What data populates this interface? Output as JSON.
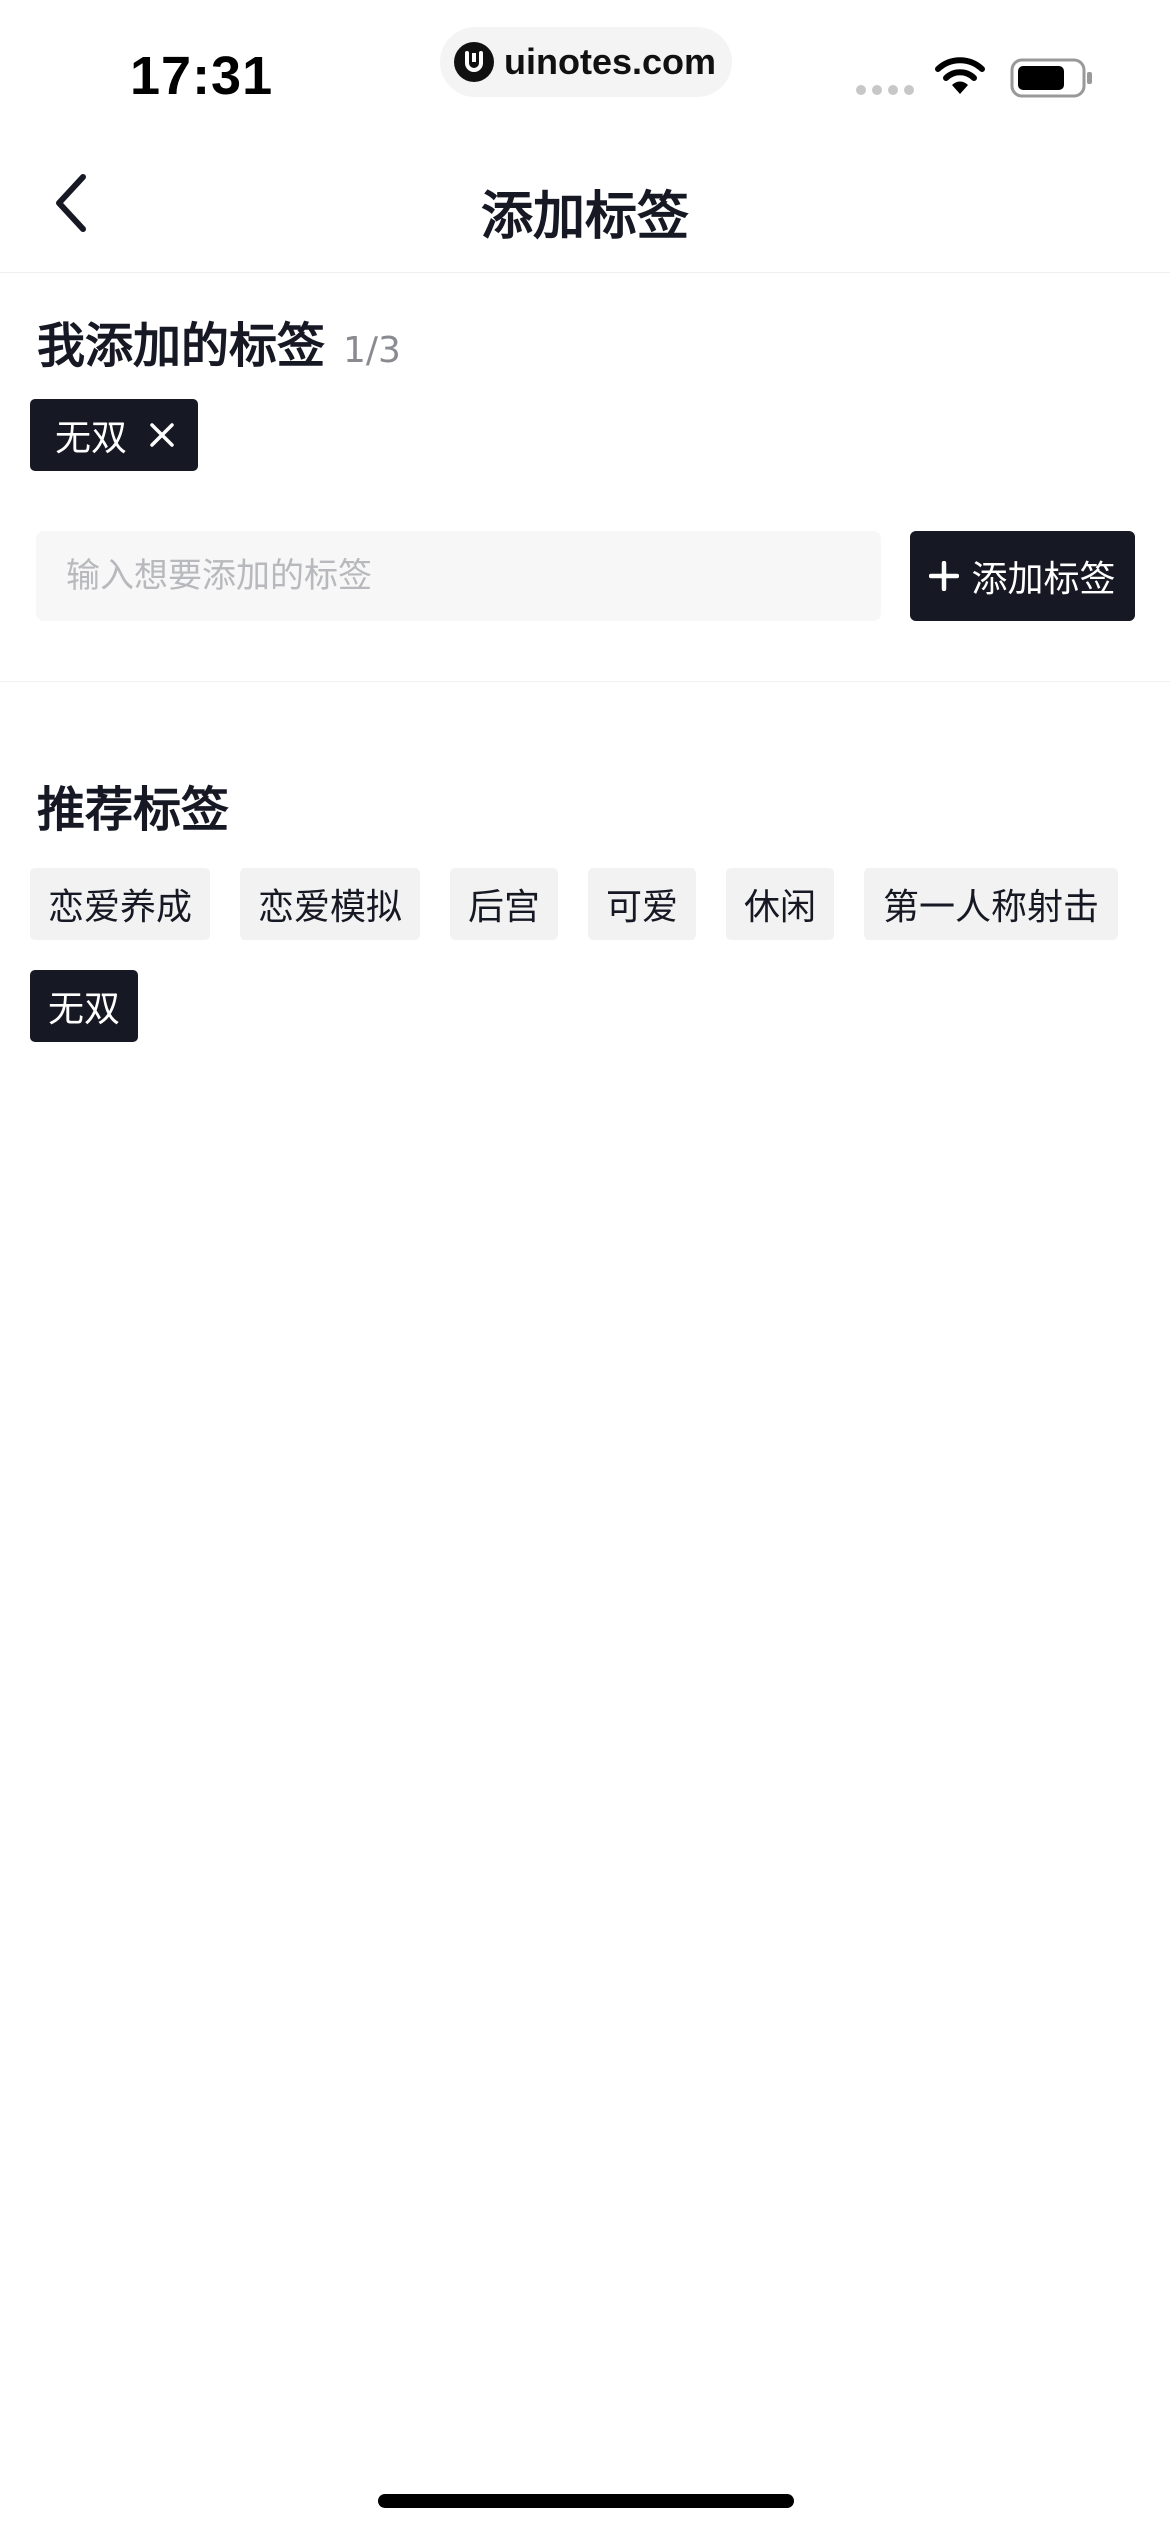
{
  "status_bar": {
    "time": "17:31",
    "url": "uinotes.com",
    "icons": [
      "signal-icon",
      "wifi-icon",
      "battery-icon"
    ]
  },
  "nav": {
    "title": "添加标签",
    "back_icon": "chevron-left-icon"
  },
  "my_tags": {
    "title": "我添加的标签",
    "count": "1/3",
    "tags": [
      {
        "label": "无双"
      }
    ]
  },
  "input": {
    "placeholder": "输入想要添加的标签",
    "value": ""
  },
  "add_button": {
    "label": "添加标签",
    "icon": "plus-icon"
  },
  "recommended": {
    "title": "推荐标签",
    "tags": [
      {
        "label": "恋爱养成",
        "selected": false
      },
      {
        "label": "恋爱模拟",
        "selected": false
      },
      {
        "label": "后宫",
        "selected": false
      },
      {
        "label": "可爱",
        "selected": false
      },
      {
        "label": "休闲",
        "selected": false
      },
      {
        "label": "第一人称射击",
        "selected": false
      },
      {
        "label": "无双",
        "selected": true
      }
    ]
  },
  "colors": {
    "primary": "#161823",
    "chip_bg": "#f2f2f2",
    "input_bg": "#f7f7f7",
    "placeholder": "#b8b9bd",
    "muted": "#8a8b91"
  }
}
